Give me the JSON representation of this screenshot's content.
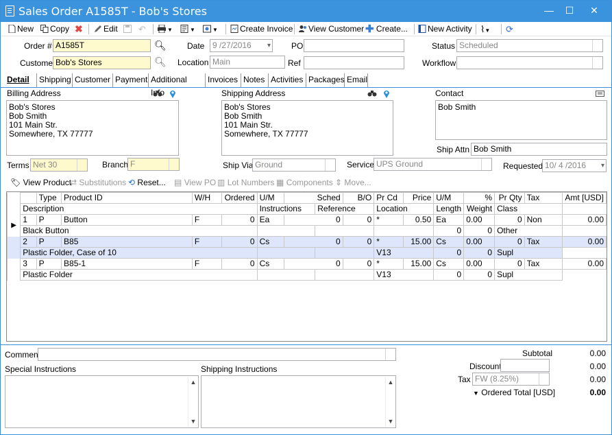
{
  "window": {
    "title": "Sales Order A1585T - Bob's Stores",
    "minimize": "—",
    "maximize": "☐",
    "close": "✕"
  },
  "toolbar": {
    "new": "New",
    "copy": "Copy",
    "edit": "Edit",
    "create_invoice": "Create Invoice",
    "view_customer": "View Customer",
    "create": "Create...",
    "new_activity": "New Activity"
  },
  "header": {
    "order_label": "Order #",
    "order_value": "A1585T",
    "date_label": "Date",
    "date_value": "9 /27/2016",
    "po_label": "PO",
    "po_value": "",
    "status_label": "Status",
    "status_value": "Scheduled",
    "customer_label": "Customer",
    "customer_value": "Bob's Stores",
    "location_label": "Location",
    "location_value": "Main",
    "ref_label": "Ref",
    "ref_value": "",
    "workflow_label": "Workflow",
    "workflow_value": ""
  },
  "tabs": [
    "Detail",
    "Shipping",
    "Customer",
    "Payment",
    "Additional Info",
    "Invoices",
    "Notes",
    "Activities",
    "Packages",
    "Email"
  ],
  "billing": {
    "label": "Billing Address",
    "lines": [
      "Bob's Stores",
      "Bob Smith",
      "101 Main Str.",
      "Somewhere, TX 77777"
    ]
  },
  "shipping": {
    "label": "Shipping Address",
    "lines": [
      "Bob's Stores",
      "Bob Smith",
      "101 Main Str.",
      "Somewhere, TX 77777"
    ]
  },
  "contact": {
    "label": "Contact",
    "value": "Bob Smith",
    "ship_attn_label": "Ship Attn",
    "ship_attn_value": "Bob Smith"
  },
  "terms": {
    "terms_label": "Terms",
    "terms_value": "Net 30",
    "branch_label": "Branch",
    "branch_value": "F",
    "ship_via_label": "Ship Via",
    "ship_via_value": "Ground",
    "service_label": "Service",
    "service_value": "UPS Ground",
    "requested_label": "Requested",
    "requested_value": "10/ 4 /2016"
  },
  "item_toolbar": {
    "view_product": "View Product",
    "substitutions": "Substitutions",
    "reset": "Reset...",
    "view_po": "View PO",
    "lot_numbers": "Lot Numbers",
    "components": "Components",
    "move": "Move..."
  },
  "grid": {
    "header1": [
      "",
      "Type",
      "Product ID",
      "W/H",
      "Ordered",
      "U/M",
      "Sched",
      "B/O",
      "Pr Cd",
      "Price",
      "U/M",
      "%",
      "Pr Qty",
      "Tax",
      "Amt [USD]"
    ],
    "header2": [
      "Description",
      "Instructions",
      "Reference",
      "Location",
      "Length",
      "Weight",
      "Class"
    ],
    "rows": [
      {
        "line": "1",
        "type": "P",
        "product": "Button",
        "wh": "F",
        "ordered": "0",
        "um": "Ea",
        "sched": "0",
        "bo": "0",
        "prcd": "*",
        "price": "0.50",
        "um2": "Ea",
        "pct": "0.00",
        "prqty": "0",
        "tax": "Non",
        "amt": "0.00",
        "desc": "Black Button",
        "instructions": "",
        "reference": "",
        "location": "",
        "length": "0",
        "weight": "0",
        "class": "Other"
      },
      {
        "line": "2",
        "type": "P",
        "product": "B85",
        "wh": "F",
        "ordered": "0",
        "um": "Cs",
        "sched": "0",
        "bo": "0",
        "prcd": "*",
        "price": "15.00",
        "um2": "Cs",
        "pct": "0.00",
        "prqty": "0",
        "tax": "Tax",
        "amt": "0.00",
        "desc": "Plastic Folder, Case of 10",
        "instructions": "",
        "reference": "",
        "location": "V13",
        "length": "0",
        "weight": "0",
        "class": "Supl"
      },
      {
        "line": "3",
        "type": "P",
        "product": "B85-1",
        "wh": "F",
        "ordered": "0",
        "um": "Cs",
        "sched": "0",
        "bo": "0",
        "prcd": "*",
        "price": "15.00",
        "um2": "Cs",
        "pct": "0.00",
        "prqty": "0",
        "tax": "Tax",
        "amt": "0.00",
        "desc": "Plastic Folder",
        "instructions": "",
        "reference": "",
        "location": "V13",
        "length": "0",
        "weight": "0",
        "class": "Supl"
      }
    ]
  },
  "footer": {
    "comment_label": "Comment",
    "special_label": "Special Instructions",
    "shipping_instr_label": "Shipping Instructions",
    "subtotal_label": "Subtotal",
    "subtotal_value": "0.00",
    "discount_label": "Discount",
    "discount_value": "0.00",
    "tax_label": "Tax",
    "tax_field": "FW (8.25%)",
    "tax_value": "0.00",
    "ordered_total_label": "Ordered Total [USD]",
    "ordered_total_value": "0.00"
  },
  "colors": {
    "titlebar": "#3a93dc",
    "required_field": "#fffacd",
    "selected_row": "#dde6fa"
  }
}
